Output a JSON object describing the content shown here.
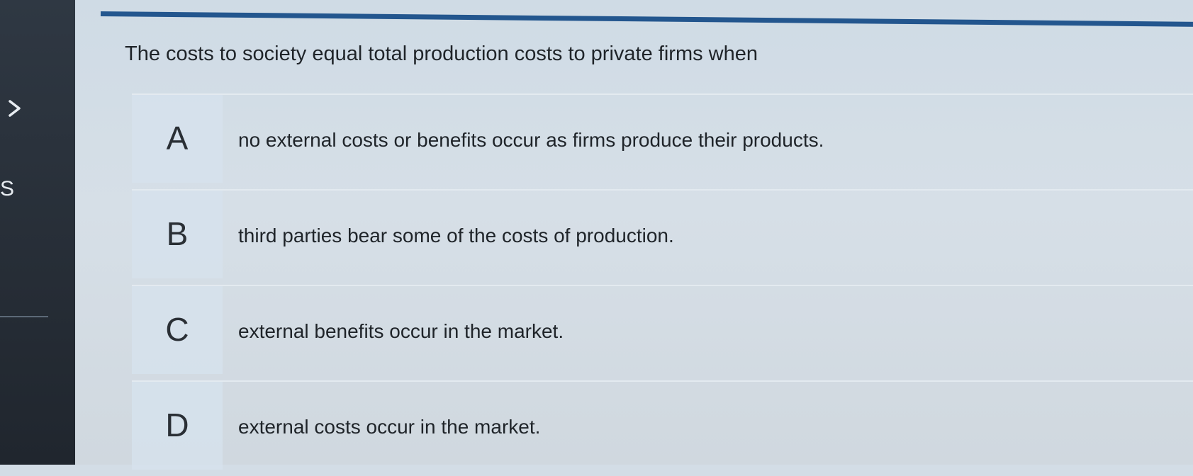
{
  "sidebar": {
    "partial_text": "S"
  },
  "question": {
    "text": "The costs to society equal total production costs to private firms when"
  },
  "options": [
    {
      "letter": "A",
      "text": "no external costs or benefits occur as firms produce their products."
    },
    {
      "letter": "B",
      "text": "third parties bear some of the costs of production."
    },
    {
      "letter": "C",
      "text": "external benefits occur in the market."
    },
    {
      "letter": "D",
      "text": "external costs occur in the market."
    }
  ],
  "colors": {
    "accent_rule": "#23568e",
    "sidebar_bg": "#2b333d",
    "content_bg": "#d3dde6"
  },
  "icons": {
    "sidebar_toggle": "chevron-right-icon"
  }
}
